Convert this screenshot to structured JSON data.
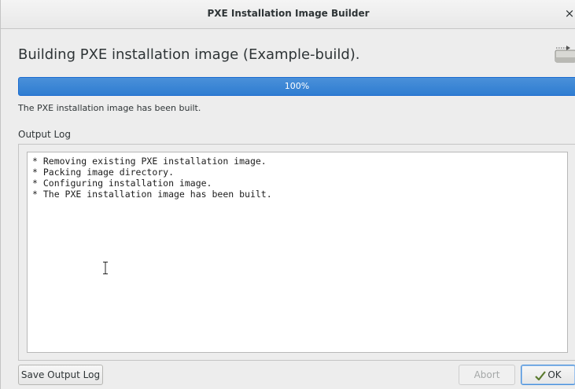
{
  "window": {
    "title": "PXE Installation Image Builder",
    "close_glyph": "×"
  },
  "heading": {
    "text": "Building PXE installation image (Example-build).",
    "icon": "network-boot-icon"
  },
  "progress": {
    "value": 1.0,
    "label": "100%",
    "color": "#3584e4"
  },
  "status": {
    "text": "The PXE installation image has been built."
  },
  "log": {
    "label": "Output Log",
    "lines": [
      "* Removing existing PXE installation image.",
      "* Packing image directory.",
      "* Configuring installation image.",
      "* The PXE installation image has been built."
    ]
  },
  "buttons": {
    "save_log": "Save Output Log",
    "abort": "Abort",
    "ok": "OK"
  }
}
